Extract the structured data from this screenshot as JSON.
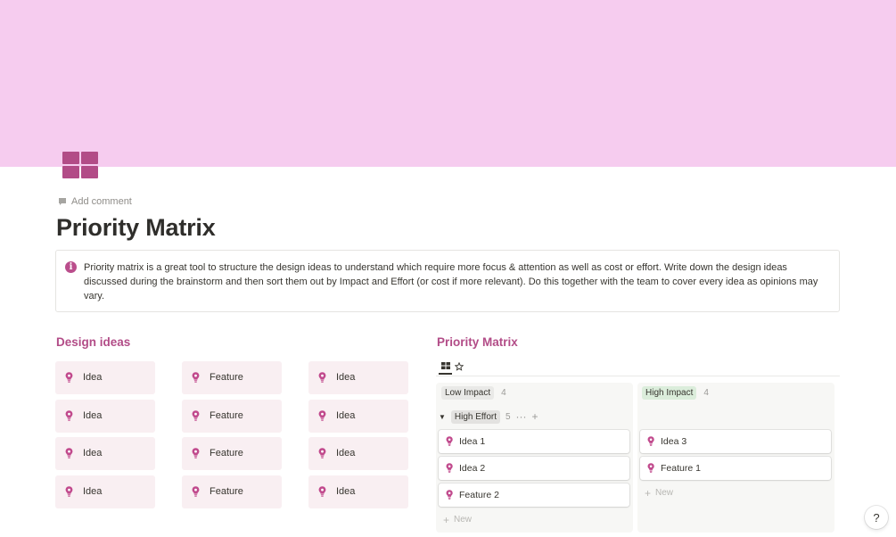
{
  "page": {
    "title": "Priority Matrix",
    "add_comment": "Add comment",
    "icon": "four-squares-icon",
    "cover_color": "#f6ccef",
    "accent_color": "#b24c87"
  },
  "callout": {
    "icon": "info-icon",
    "icon_glyph": "i",
    "text": "Priority matrix is a great tool to structure the design ideas to understand which require more focus & attention as well as cost or effort. Write down the design ideas discussed during the brainstorm and then sort them out by Impact and Effort (or cost if more relevant). Do this together with the team to cover every idea as opinions may vary."
  },
  "design_ideas": {
    "title": "Design ideas",
    "columns": [
      [
        "Idea",
        "Idea",
        "Idea",
        "Idea"
      ],
      [
        "Feature",
        "Feature",
        "Feature",
        "Feature"
      ],
      [
        "Idea",
        "Idea",
        "Idea",
        "Idea"
      ]
    ]
  },
  "priority_matrix": {
    "title": "Priority Matrix",
    "views": [
      "board-view-icon",
      "star-icon"
    ],
    "columns": [
      {
        "label": "Low Impact",
        "count": "4"
      },
      {
        "label": "High Impact",
        "count": "4"
      }
    ],
    "group": {
      "toggle": "▼",
      "label": "High Effort",
      "count": "5",
      "more": "···",
      "add": "+"
    },
    "cards": {
      "low": [
        "Idea 1",
        "Idea 2",
        "Feature 2"
      ],
      "high": [
        "Idea 3",
        "Feature 1"
      ]
    },
    "new_label": "New"
  },
  "help": {
    "label": "?"
  }
}
